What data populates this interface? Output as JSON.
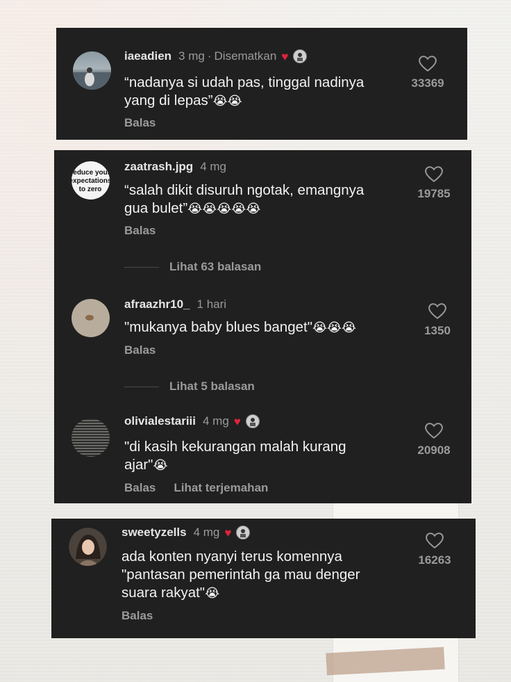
{
  "colors": {
    "panel": "#202020",
    "muted": "#9a9a9a",
    "pin_heart": "#e0243a"
  },
  "comments": [
    {
      "username": "iaeadien",
      "time": "3 mg",
      "pinned_label": "Disematkan",
      "text": "“nadanya si udah pas, tinggal nadinya yang di lepas”",
      "emoji": "😭😭",
      "reply": "Balas",
      "likes": "33369",
      "avatar_icon": "sea-photo"
    },
    {
      "username": "zaatrash.jpg",
      "time": "4 mg",
      "text": "“salah dikit disuruh ngotak, emangnya gua bulet”",
      "emoji": "😭😭😭😭😭",
      "reply": "Balas",
      "likes": "19785",
      "avatar_icon": "text-sticker",
      "avatar_text": "reduce your expectations to zero",
      "view_replies": "Lihat 63 balasan"
    },
    {
      "username": "afraazhr10_",
      "time": "1 hari",
      "text": "\"mukanya baby blues banget\"",
      "emoji": "😭😭😭",
      "reply": "Balas",
      "likes": "1350",
      "avatar_icon": "beige-photo",
      "view_replies": "Lihat 5 balasan"
    },
    {
      "username": "olivialestariii",
      "time": "4 mg",
      "text": "\"di kasih kekurangan malah kurang ajar\"",
      "emoji": "😭",
      "reply": "Balas",
      "translate": "Lihat terjemahan",
      "likes": "20908",
      "avatar_icon": "striped-photo"
    },
    {
      "username": "sweetyzells",
      "time": "4 mg",
      "text": "ada konten nyanyi terus komennya \"pantasan pemerintah ga mau denger suara rakyat\"",
      "emoji": "😭",
      "reply": "Balas",
      "likes": "16263",
      "avatar_icon": "anime-girl"
    }
  ]
}
